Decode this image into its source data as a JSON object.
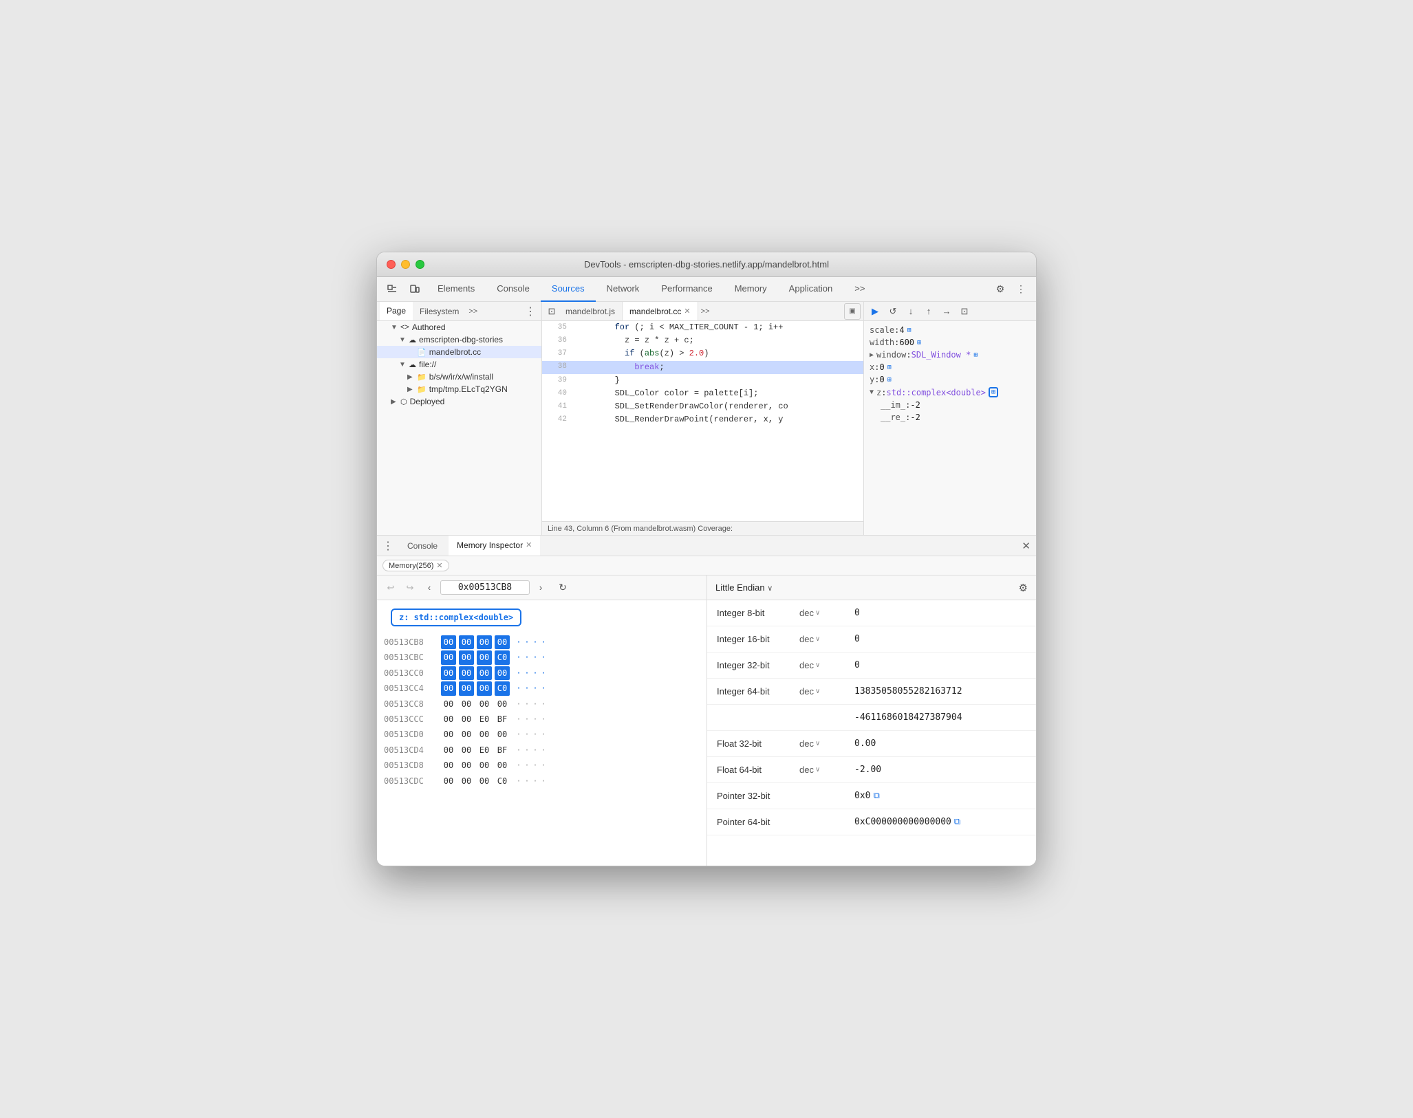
{
  "window": {
    "title": "DevTools - emscripten-dbg-stories.netlify.app/mandelbrot.html"
  },
  "top_tabs": {
    "items": [
      "Elements",
      "Console",
      "Sources",
      "Network",
      "Performance",
      "Memory",
      "Application",
      ">>"
    ],
    "active": "Sources"
  },
  "secondary_tabs": {
    "items": [
      "Page",
      "Filesystem",
      ">>"
    ],
    "active": "Page"
  },
  "code_tabs": {
    "items": [
      "mandelbrot.js",
      "mandelbrot.cc"
    ],
    "active": "mandelbrot.cc",
    "active_closable": true,
    "more": ">>"
  },
  "file_tree": {
    "items": [
      {
        "indent": 0,
        "arrow": "▼",
        "icon": "<>",
        "label": "Authored"
      },
      {
        "indent": 1,
        "arrow": "▼",
        "icon": "☁",
        "label": "emscripten-dbg-stories"
      },
      {
        "indent": 2,
        "arrow": "",
        "icon": "📄",
        "label": "mandelbrot.cc",
        "selected": true
      },
      {
        "indent": 1,
        "arrow": "▼",
        "icon": "☁",
        "label": "file://"
      },
      {
        "indent": 2,
        "arrow": "▶",
        "icon": "📁",
        "label": "b/s/w/ir/x/w/install"
      },
      {
        "indent": 2,
        "arrow": "▶",
        "icon": "📁",
        "label": "tmp/tmp.ELcTq2YGN"
      },
      {
        "indent": 0,
        "arrow": "▶",
        "icon": "⬡",
        "label": "Deployed"
      }
    ]
  },
  "code_lines": [
    {
      "num": "35",
      "text": "        for (; i < MAX_ITER_COUNT - 1; i++",
      "highlight": false
    },
    {
      "num": "36",
      "text": "          z = z * z + c;",
      "highlight": false
    },
    {
      "num": "37",
      "text": "          if (abs(z) > 2.0)",
      "highlight": false
    },
    {
      "num": "38",
      "text": "            break;",
      "highlight": true
    },
    {
      "num": "39",
      "text": "        }",
      "highlight": false
    },
    {
      "num": "40",
      "text": "        SDL_Color color = palette[i];",
      "highlight": false
    },
    {
      "num": "41",
      "text": "        SDL_SetRenderDrawColor(renderer, co",
      "highlight": false
    },
    {
      "num": "42",
      "text": "        SDL_RenderDrawPoint(renderer, x, y",
      "highlight": false
    }
  ],
  "status_bar": {
    "text": "Line 43, Column 6 (From mandelbrot.wasm)  Coverage:"
  },
  "vars_panel": {
    "items": [
      {
        "indent": 0,
        "key": "scale",
        "colon": ": ",
        "val": "4",
        "icon": "⊞"
      },
      {
        "indent": 0,
        "key": "width",
        "colon": ": ",
        "val": "600",
        "icon": "⊞"
      },
      {
        "indent": 0,
        "key": "▶ window",
        "colon": ": ",
        "val": "SDL_Window *",
        "icon": "⊞"
      },
      {
        "indent": 0,
        "key": "x",
        "colon": ": ",
        "val": "0",
        "icon": "⊞"
      },
      {
        "indent": 0,
        "key": "y",
        "colon": ": ",
        "val": "0",
        "icon": "⊞"
      },
      {
        "indent": 0,
        "key": "▼ z",
        "colon": ": ",
        "val": "std::complex<double>",
        "icon": "⊞",
        "highlight_box": true
      },
      {
        "indent": 1,
        "key": "__im_",
        "colon": ": ",
        "val": "-2",
        "icon": ""
      },
      {
        "indent": 1,
        "key": "__re_",
        "colon": ": ",
        "val": "-2",
        "icon": ""
      }
    ]
  },
  "bottom_tabs": {
    "items": [
      "Console",
      "Memory Inspector"
    ],
    "active": "Memory Inspector",
    "closable": true
  },
  "memory_chip": {
    "label": "Memory(256)",
    "closable": true
  },
  "hex_toolbar": {
    "address": "0x00513CB8"
  },
  "var_highlight": {
    "label": "z: std::complex<double>"
  },
  "hex_rows": [
    {
      "addr": "00513CB8",
      "bytes": [
        "00",
        "00",
        "00",
        "00"
      ],
      "highlighted": [
        true,
        true,
        true,
        true
      ],
      "ascii": [
        "·",
        "·",
        "·",
        "·"
      ]
    },
    {
      "addr": "00513CBC",
      "bytes": [
        "00",
        "00",
        "00",
        "C0"
      ],
      "highlighted": [
        true,
        true,
        true,
        true
      ],
      "ascii": [
        "·",
        "·",
        "·",
        "·"
      ]
    },
    {
      "addr": "00513CC0",
      "bytes": [
        "00",
        "00",
        "00",
        "00"
      ],
      "highlighted": [
        true,
        true,
        true,
        true
      ],
      "ascii": [
        "·",
        "·",
        "·",
        "·"
      ]
    },
    {
      "addr": "00513CC4",
      "bytes": [
        "00",
        "00",
        "00",
        "C0"
      ],
      "highlighted": [
        true,
        true,
        true,
        true
      ],
      "ascii": [
        "·",
        "·",
        "·",
        "·"
      ]
    },
    {
      "addr": "00513CC8",
      "bytes": [
        "00",
        "00",
        "00",
        "00"
      ],
      "highlighted": [
        false,
        false,
        false,
        false
      ],
      "ascii": [
        "·",
        "·",
        "·",
        "·"
      ]
    },
    {
      "addr": "00513CCC",
      "bytes": [
        "00",
        "00",
        "E0",
        "BF"
      ],
      "highlighted": [
        false,
        false,
        false,
        false
      ],
      "ascii": [
        "·",
        "·",
        "·",
        "·"
      ]
    },
    {
      "addr": "00513CD0",
      "bytes": [
        "00",
        "00",
        "00",
        "00"
      ],
      "highlighted": [
        false,
        false,
        false,
        false
      ],
      "ascii": [
        "·",
        "·",
        "·",
        "·"
      ]
    },
    {
      "addr": "00513CD4",
      "bytes": [
        "00",
        "00",
        "E0",
        "BF"
      ],
      "highlighted": [
        false,
        false,
        false,
        false
      ],
      "ascii": [
        "·",
        "·",
        "·",
        "·"
      ]
    },
    {
      "addr": "00513CD8",
      "bytes": [
        "00",
        "00",
        "00",
        "00"
      ],
      "highlighted": [
        false,
        false,
        false,
        false
      ],
      "ascii": [
        "·",
        "·",
        "·",
        "·"
      ]
    },
    {
      "addr": "00513CDC",
      "bytes": [
        "00",
        "00",
        "00",
        "C0"
      ],
      "highlighted": [
        false,
        false,
        false,
        false
      ],
      "ascii": [
        "·",
        "·",
        "·",
        "·"
      ]
    }
  ],
  "endian": {
    "label": "Little Endian",
    "arrow": "∨"
  },
  "interpretations": [
    {
      "type": "Integer 8-bit",
      "enc": "dec",
      "val": "0"
    },
    {
      "type": "Integer 16-bit",
      "enc": "dec",
      "val": "0"
    },
    {
      "type": "Integer 32-bit",
      "enc": "dec",
      "val": "0"
    },
    {
      "type": "Integer 64-bit",
      "enc": "dec",
      "val": "13835058055282163712"
    },
    {
      "type": "",
      "enc": "",
      "val": "-4611686018427387904"
    },
    {
      "type": "Float 32-bit",
      "enc": "dec",
      "val": "0.00"
    },
    {
      "type": "Float 64-bit",
      "enc": "dec",
      "val": "-2.00"
    },
    {
      "type": "Pointer 32-bit",
      "enc": "",
      "val": "0x0",
      "link": true
    },
    {
      "type": "Pointer 64-bit",
      "enc": "",
      "val": "0xC000000000000000",
      "link": true
    }
  ]
}
